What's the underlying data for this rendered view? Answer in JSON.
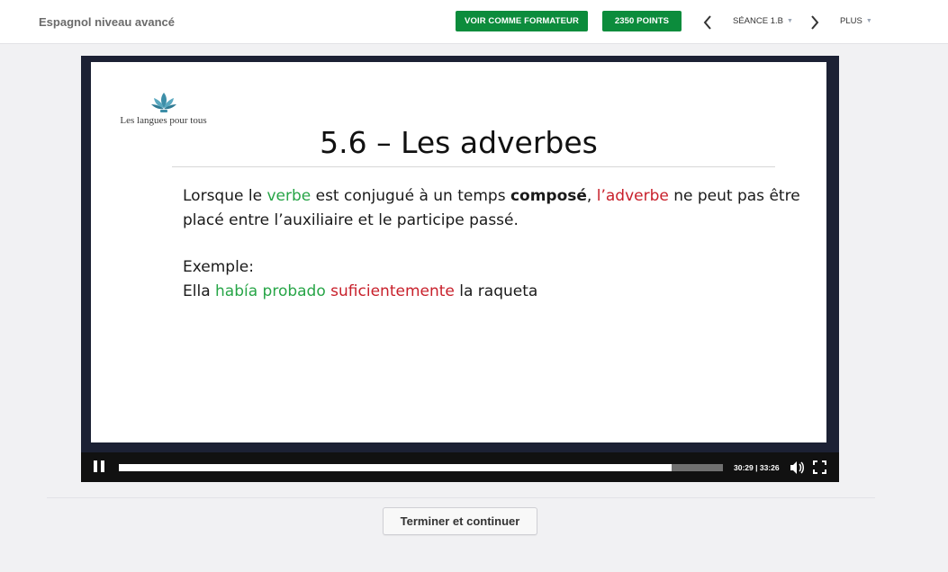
{
  "header": {
    "course_title": "Espagnol niveau avancé",
    "trainer_button": "VOIR COMME FORMATEUR",
    "points_button": "2350 POINTS",
    "session_label": "SÉANCE 1.B",
    "more_label": "PLUS"
  },
  "slide": {
    "logo_text": "Les langues pour tous",
    "title": "5.6 – Les adverbes",
    "p1_a": "Lorsque le ",
    "p1_verbe": "verbe",
    "p1_b": " est conjugué à un temps ",
    "p1_compose": "composé",
    "p1_c": ", ",
    "p1_adverbe": "l’adverbe",
    "p1_d": " ne peut pas être placé entre l’auxiliaire et le participe passé.",
    "example_label": "Exemple:",
    "ex_a": "Ella ",
    "ex_verb": "había probado",
    "ex_b": " ",
    "ex_adverb": "suficientemente",
    "ex_c": " la raqueta"
  },
  "player": {
    "time": "30:29 | 33:26",
    "progress": 0.915,
    "icons": [
      "pause-icon",
      "volume-icon",
      "fullscreen-icon"
    ]
  },
  "footer": {
    "finish_button": "Terminer et continuer"
  },
  "colors": {
    "accent_green": "#0c8c3c",
    "highlight_green": "#27a547",
    "highlight_red": "#c8202b",
    "player_frame": "#1c2134"
  }
}
